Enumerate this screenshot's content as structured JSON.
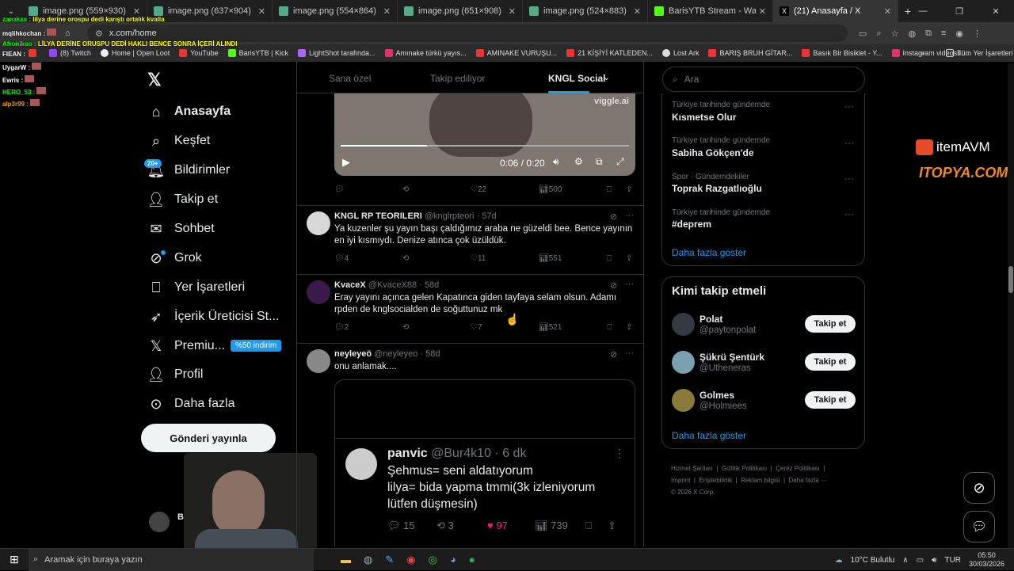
{
  "tabs": [
    {
      "title": "image.png (559×930)"
    },
    {
      "title": "image.png (637×904)"
    },
    {
      "title": "image.png (554×864)"
    },
    {
      "title": "image.png (651×908)"
    },
    {
      "title": "image.png (524×883)"
    },
    {
      "title": "BarisYTB Stream - Watch Live o"
    },
    {
      "title": "(21) Anasayfa / X"
    }
  ],
  "new_tab": "+",
  "url": "x.com/home",
  "bookmarks": [
    "(8) Twitch",
    "Home | Open Loot",
    "YouTube",
    "BarisYTB | Kick",
    "LightShot tarafında...",
    "Amınake türkü yayıs...",
    "AMINAKE VURUŞU...",
    "21 KİŞİYİ KATLEDEN...",
    "Lost Ark",
    "BARIŞ BRUH GİTAR...",
    "Basık Bir Bisiklet - Y...",
    "Instagram videosu:..."
  ],
  "bookmarks_all": "Tüm Yer İşaretleri",
  "chat": [
    {
      "user": "zanaksx :",
      "msg": "lilya derine orospu dedi karıştı ortalık kvalla"
    },
    {
      "user": "mqlihkochan :",
      "msg": ""
    },
    {
      "user": "Afronikoo :",
      "msg": "LİLYA DERİNE ORUSPU DEDİ HAKLI BENCE SONRA İÇERİ ALINDI"
    },
    {
      "user": "FIEAN :",
      "msg": ""
    },
    {
      "user": "UygarW :",
      "msg": ""
    },
    {
      "user": "Ewris :",
      "msg": ""
    },
    {
      "user": "HERO_53 :",
      "msg": ""
    },
    {
      "user": "alp3r99 :",
      "msg": ""
    }
  ],
  "nav": {
    "home": "Anasayfa",
    "explore": "Keşfet",
    "notifications": "Bildirimler",
    "notif_badge": "20+",
    "follow": "Takip et",
    "messages": "Sohbet",
    "grok": "Grok",
    "bookmarks": "Yer İşaretleri",
    "creator": "İçerik Üreticisi St...",
    "premium": "Premiu...",
    "premium_badge": "%50 indirim",
    "profile": "Profil",
    "more": "Daha fazla",
    "post_button": "Gönderi yayınla",
    "account_initial": "B"
  },
  "feed_tabs": {
    "t1": "Sana özel",
    "t2": "Takip ediliyor",
    "t3": "KNGL Social"
  },
  "video": {
    "time": "0:06 / 0:20",
    "watermark": "viggle.ai",
    "progress": 0.3
  },
  "first_tweet_actions": {
    "replies": "",
    "retweets": "",
    "likes": "22",
    "views": "500"
  },
  "tweets": [
    {
      "name": "KNGL RP TEORILERI",
      "handle": "@knglrpteori",
      "time": "57d",
      "text": "Ya kuzenler şu yayın başı çaldığımız araba ne güzeldi bee. Bence yayının en iyi kısmıydı. Denize atınca çok üzüldük.",
      "replies": "4",
      "retweets": "",
      "likes": "11",
      "views": "551"
    },
    {
      "name": "KvaceX",
      "handle": "@KvaceX88",
      "time": "58d",
      "text": "Eray yayını açınca gelen Kapatınca giden tayfaya selam olsun. Adamı rpden de knglsocialden de soğuttunuz mk",
      "replies": "2",
      "retweets": "",
      "likes": "7",
      "views": "521"
    },
    {
      "name": "neyleyeö",
      "handle": "@neyleyeo",
      "time": "58d",
      "text": "onu anlamak....",
      "replies": "",
      "retweets": "",
      "likes": "",
      "views": ""
    }
  ],
  "quoted": {
    "name": "panvic",
    "handle": "@Bur4k10",
    "time": "6 dk",
    "line1": "Şehmus= seni aldatıyorum",
    "line2": "lilya= bida yapma tmmi(3k izleniyorum",
    "line3": "lütfen düşmesin)",
    "replies": "15",
    "retweets": "3",
    "likes": "97",
    "views": "739"
  },
  "search": {
    "placeholder": "Ara"
  },
  "trends": [
    {
      "sub": "Türkiye tarihinde gündemde",
      "title": "Kısmetse Olur"
    },
    {
      "sub": "Türkiye tarihinde gündemde",
      "title": "Sabiha Gökçen'de"
    },
    {
      "sub": "Spor · Gündemdekiler",
      "title": "Toprak Razgatlıoğlu"
    },
    {
      "sub": "Türkiye tarihinde gündemde",
      "title": "#deprem"
    }
  ],
  "show_more": "Daha fazla göster",
  "who_to_follow": {
    "title": "Kimi takip etmeli",
    "users": [
      {
        "name": "Polat",
        "handle": "@paytonpolat",
        "button": "Takip et"
      },
      {
        "name": "Şükrü Şentürk",
        "handle": "@Utheneras",
        "button": "Takip et"
      },
      {
        "name": "Golmes",
        "handle": "@Holmiees",
        "button": "Takip et"
      }
    ],
    "show_more": "Daha fazla göster"
  },
  "footer": {
    "links": [
      "Hizmet Şartları",
      "Gizlilik Politikası",
      "Çerez Politikası",
      "Imprint",
      "Erişilebilirlik",
      "Reklam bilgisi",
      "Daha fazla ···"
    ],
    "copyright": "© 2026 X Corp."
  },
  "overlay": {
    "brand1": "itemAVM",
    "brand2": "ITOPYA.COM"
  },
  "taskbar": {
    "search": "Aramak için buraya yazın",
    "weather": "10°C Bulutlu",
    "lang": "TUR",
    "time": "05:50",
    "date": "30/03/2026"
  },
  "colors": {
    "accent": "#1d9bf0",
    "bg": "#000000",
    "border": "#2f3336",
    "muted": "#71767b",
    "like_pink": "#f91880"
  }
}
